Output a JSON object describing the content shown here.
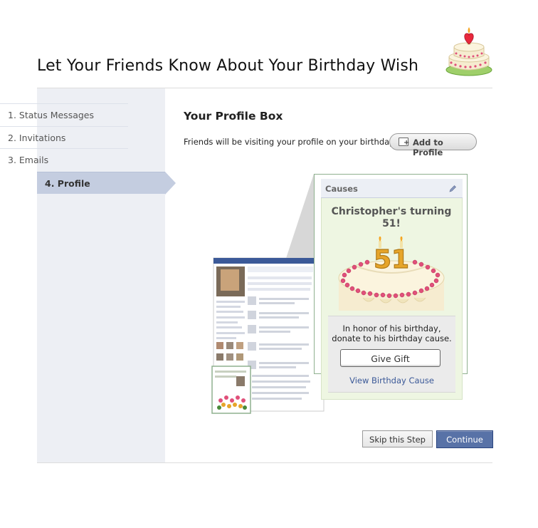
{
  "header": {
    "title": "Let Your Friends Know About Your Birthday Wish"
  },
  "sidebar": {
    "steps": [
      {
        "label": "1. Status Messages"
      },
      {
        "label": "2. Invitations"
      },
      {
        "label": "3. Emails"
      },
      {
        "label": "4. Profile",
        "active": true
      }
    ]
  },
  "main": {
    "section_title": "Your Profile Box",
    "description": "Friends will be visiting your profile on your birthday:",
    "add_button": "Add to Profile"
  },
  "causes_box": {
    "title": "Causes",
    "turning_line1": "Christopher's turning",
    "turning_line2": "51!",
    "cake_number": "51",
    "honor_line1": "In honor of his birthday,",
    "honor_line2": "donate to his birthday cause.",
    "gift_button": "Give Gift",
    "view_link": "View Birthday Cause"
  },
  "footer": {
    "skip_button": "Skip this Step",
    "continue_button": "Continue"
  },
  "colors": {
    "accent": "#3b5998",
    "continue_bg": "#5872a7",
    "sidebar_bg": "#edeff4",
    "active_step": "#c4cde0",
    "causes_bg": "#eef6e2",
    "cake_pink": "#e0507a",
    "cake_gold": "#e6a52a"
  },
  "icons": {
    "cake_logo": "birthday-cake-icon",
    "add_profile": "add-box-icon",
    "edit": "pencil-icon"
  }
}
